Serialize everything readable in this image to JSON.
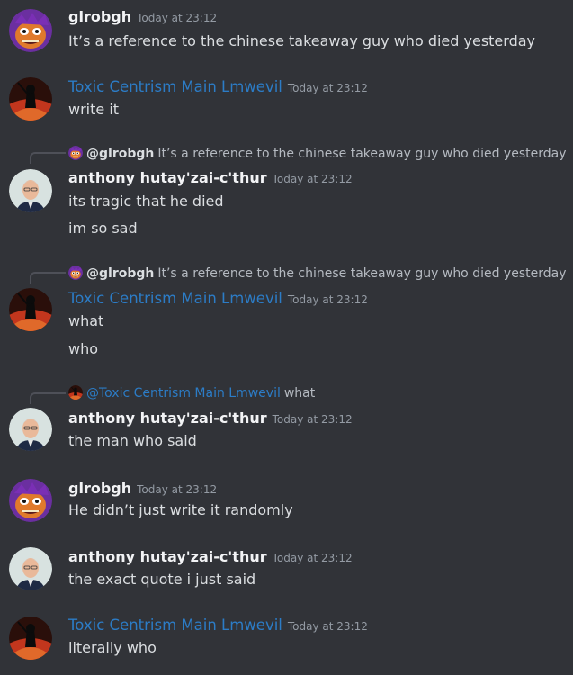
{
  "messages": [
    {
      "author": "glrobgh",
      "timestamp": "Today at 23:12",
      "lines": [
        "It’s a reference to the chinese takeaway guy who died yesterday"
      ]
    },
    {
      "author": "Toxic Centrism Main Lmwevil",
      "timestamp": "Today at 23:12",
      "lines": [
        "write it"
      ]
    },
    {
      "reply": {
        "author": "@glrobgh",
        "text": "It’s a reference to the chinese takeaway guy who died yesterday"
      },
      "author": "anthony hutay'zai-c'thur",
      "timestamp": "Today at 23:12",
      "lines": [
        "its tragic that he died",
        "im so sad"
      ]
    },
    {
      "reply": {
        "author": "@glrobgh",
        "text": "It’s a reference to the chinese takeaway guy who died yesterday"
      },
      "author": "Toxic Centrism Main Lmwevil",
      "timestamp": "Today at 23:12",
      "lines": [
        "what",
        "who"
      ]
    },
    {
      "reply": {
        "author": "@Toxic Centrism Main Lmwevil",
        "text": "what"
      },
      "author": "anthony hutay'zai-c'thur",
      "timestamp": "Today at 23:12",
      "lines": [
        "the man who said"
      ]
    },
    {
      "author": "glrobgh",
      "timestamp": "Today at 23:12",
      "lines": [
        "He didn’t just write it randomly"
      ]
    },
    {
      "author": "anthony hutay'zai-c'thur",
      "timestamp": "Today at 23:12",
      "lines": [
        "the exact quote i just said"
      ]
    },
    {
      "author": "Toxic Centrism Main Lmwevil",
      "timestamp": "Today at 23:12",
      "lines": [
        "literally who"
      ]
    }
  ],
  "colors": {
    "background": "#313338",
    "text": "#dbdee1",
    "username_default": "#f2f3f5",
    "username_blue": "#2c7cc6",
    "timestamp": "#949ba4"
  }
}
